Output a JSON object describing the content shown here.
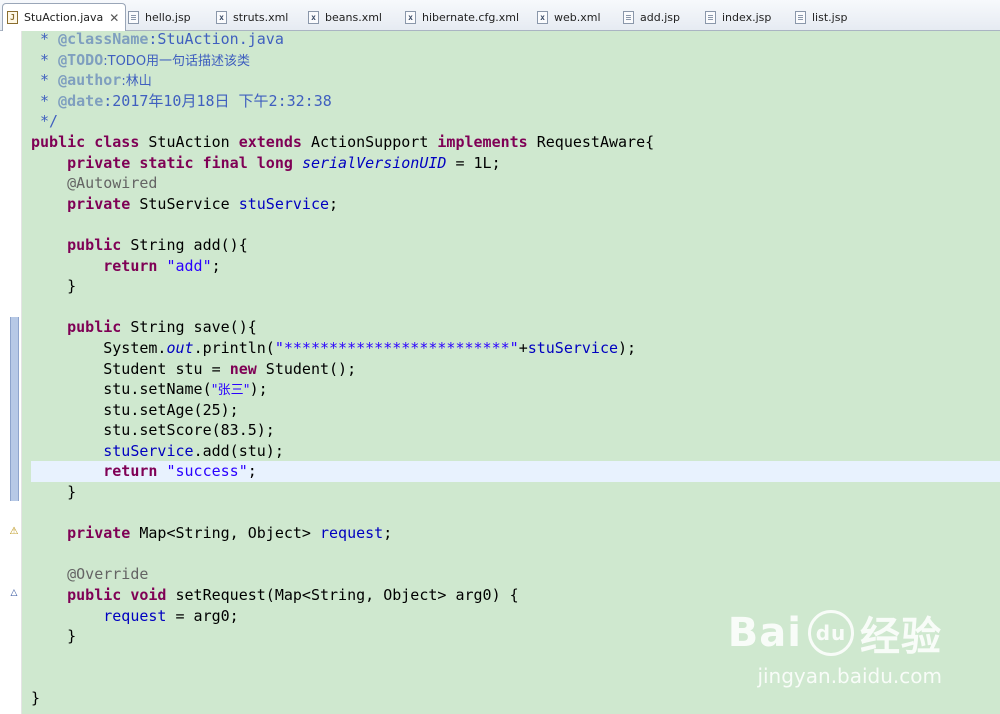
{
  "tabs": [
    {
      "label": "StuAction.java",
      "icon": "java-file-icon",
      "active": true
    },
    {
      "label": "hello.jsp",
      "icon": "jsp-file-icon"
    },
    {
      "label": "struts.xml",
      "icon": "xml-file-icon"
    },
    {
      "label": "beans.xml",
      "icon": "xml-file-icon"
    },
    {
      "label": "hibernate.cfg.xml",
      "icon": "xml-file-icon"
    },
    {
      "label": "web.xml",
      "icon": "xml-file-icon"
    },
    {
      "label": "add.jsp",
      "icon": "jsp-file-icon"
    },
    {
      "label": "index.jsp",
      "icon": "jsp-file-icon"
    },
    {
      "label": "list.jsp",
      "icon": "jsp-file-icon"
    }
  ],
  "close_glyph": "✕",
  "code": {
    "l1": {
      "a": " * ",
      "b": "@className",
      "c": ":StuAction.java"
    },
    "l2": {
      "a": " * ",
      "b": "@TODO",
      "c": ":TODO用一句话描述该类"
    },
    "l3": {
      "a": " * ",
      "b": "@author",
      "c": ":林山"
    },
    "l4": {
      "a": " * ",
      "b": "@date",
      "c": ":2017年10月18日 下午2:32:38"
    },
    "l5": {
      "a": " */"
    },
    "l6": {
      "a": "public",
      "b": " ",
      "c": "class",
      "d": " StuAction ",
      "e": "extends",
      "f": " ActionSupport ",
      "g": "implements",
      "h": " RequestAware{"
    },
    "l7": {
      "a": "    ",
      "b": "private",
      "c": " ",
      "d": "static",
      "e": " ",
      "f": "final",
      "g": " ",
      "h": "long",
      "i": " ",
      "j": "serialVersionUID",
      "k": " = 1L;"
    },
    "l8": {
      "a": "    ",
      "b": "@Autowired"
    },
    "l9": {
      "a": "    ",
      "b": "private",
      "c": " StuService ",
      "d": "stuService",
      "e": ";"
    },
    "l11": {
      "a": "    ",
      "b": "public",
      "c": " String add(){"
    },
    "l12": {
      "a": "        ",
      "b": "return",
      "c": " ",
      "d": "\"add\"",
      "e": ";"
    },
    "l13": {
      "a": "    }"
    },
    "l15": {
      "a": "    ",
      "b": "public",
      "c": " String save(){"
    },
    "l16": {
      "a": "        System.",
      "b": "out",
      "c": ".println(",
      "d": "\"*************************\"",
      "e": "+",
      "f": "stuService",
      "g": ");"
    },
    "l17": {
      "a": "        Student stu = ",
      "b": "new",
      "c": " Student();"
    },
    "l18": {
      "a": "        stu.setName(",
      "b": "\"张三\"",
      "c": ");"
    },
    "l19": {
      "a": "        stu.setAge(25);"
    },
    "l20": {
      "a": "        stu.setScore(83.5);"
    },
    "l21": {
      "a": "        ",
      "b": "stuService",
      "c": ".add(stu);"
    },
    "l22": {
      "a": "        ",
      "b": "return",
      "c": " ",
      "d": "\"success\"",
      "e": ";"
    },
    "l23": {
      "a": "    }"
    },
    "l25": {
      "a": "    ",
      "b": "private",
      "c": " Map<String, Object> ",
      "d": "request",
      "e": ";"
    },
    "l27": {
      "a": "    ",
      "b": "@Override"
    },
    "l28": {
      "a": "    ",
      "b": "public",
      "c": " ",
      "d": "void",
      "e": " setRequest(Map<String, Object> arg0) {"
    },
    "l29": {
      "a": "        ",
      "b": "request",
      "c": " = arg0;"
    },
    "l30": {
      "a": "    }"
    },
    "l33": {
      "a": "}"
    }
  },
  "gutter": {
    "warning_glyph": "⚠",
    "override_glyph": "△"
  },
  "watermark": {
    "logo_left": "Bai",
    "logo_right": "经验",
    "url": "jingyan.baidu.com"
  }
}
